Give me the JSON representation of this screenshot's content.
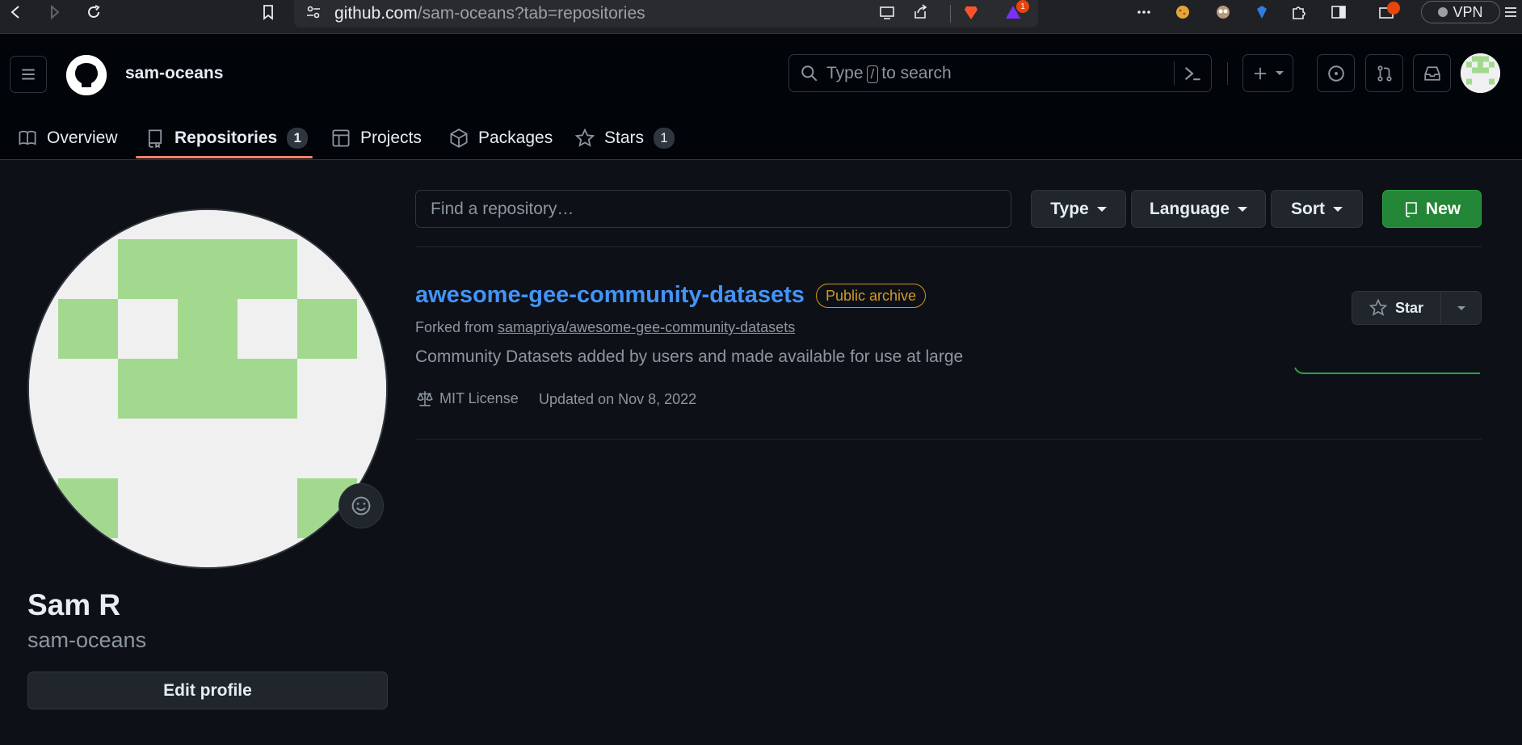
{
  "browser": {
    "url_host": "github.com",
    "url_path": "/sam-oceans?tab=repositories",
    "vpn_label": "VPN",
    "alert_count": "1"
  },
  "header": {
    "username": "sam-oceans",
    "search_prefix": "Type",
    "search_key": "/",
    "search_suffix": "to search"
  },
  "tabs": [
    {
      "label": "Overview",
      "icon": "book-icon"
    },
    {
      "label": "Repositories",
      "icon": "repo-icon",
      "count": "1",
      "active": true
    },
    {
      "label": "Projects",
      "icon": "table-icon"
    },
    {
      "label": "Packages",
      "icon": "package-icon"
    },
    {
      "label": "Stars",
      "icon": "star-icon",
      "count": "1"
    }
  ],
  "profile": {
    "full_name": "Sam R",
    "login": "sam-oceans",
    "edit_label": "Edit profile"
  },
  "filters": {
    "find_placeholder": "Find a repository…",
    "type_label": "Type",
    "language_label": "Language",
    "sort_label": "Sort",
    "new_label": "New"
  },
  "repo": {
    "name": "awesome-gee-community-datasets",
    "badge": "Public archive",
    "forked_prefix": "Forked from",
    "forked_from": "samapriya/awesome-gee-community-datasets",
    "description": "Community Datasets added by users and made available for use at large",
    "license": "MIT License",
    "updated": "Updated on Nov 8, 2022",
    "star_label": "Star"
  },
  "colors": {
    "accent_green": "#238636",
    "link_blue": "#4493f8",
    "archive_amber": "#d29922",
    "tab_underline": "#f78166"
  }
}
